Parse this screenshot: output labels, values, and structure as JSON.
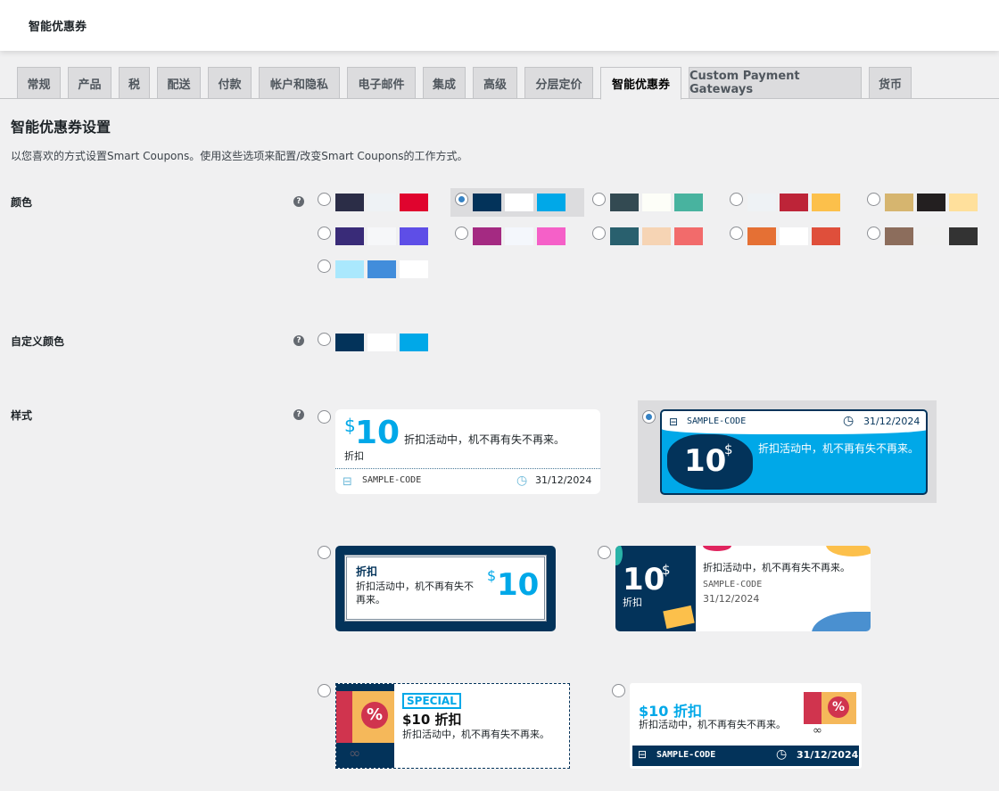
{
  "header": {
    "title": "智能优惠券"
  },
  "tabs": [
    {
      "label": "常规",
      "active": false
    },
    {
      "label": "产品",
      "active": false
    },
    {
      "label": "税",
      "active": false
    },
    {
      "label": "配送",
      "active": false
    },
    {
      "label": "付款",
      "active": false
    },
    {
      "label": "帐户和隐私",
      "active": false
    },
    {
      "label": "电子邮件",
      "active": false
    },
    {
      "label": "集成",
      "active": false
    },
    {
      "label": "高级",
      "active": false
    },
    {
      "label": "分层定价",
      "active": false
    },
    {
      "label": "智能优惠券",
      "active": true
    },
    {
      "label": "Custom Payment Gateways",
      "active": false
    },
    {
      "label": "货币",
      "active": false
    }
  ],
  "page": {
    "title": "智能优惠券设置",
    "description": "以您喜欢的方式设置Smart Coupons。使用这些选项来配置/改变Smart Coupons的工作方式。"
  },
  "settings": {
    "color_label": "颜色",
    "custom_color_label": "自定义颜色",
    "style_label": "样式",
    "help_icon": "?",
    "palettes": [
      {
        "colors": [
          "#2b2d47",
          "#eef2f5",
          "#e0042e"
        ],
        "selected": false
      },
      {
        "colors": [
          "#03335a",
          "#ffffff",
          "#00a8e8"
        ],
        "selected": true
      },
      {
        "colors": [
          "#334a52",
          "#fdfef8",
          "#48b39f"
        ],
        "selected": false
      },
      {
        "colors": [
          "#eef2f5",
          "#bd2438",
          "#fcc04b"
        ],
        "selected": false
      },
      {
        "colors": [
          "#d6b56f",
          "#231f20",
          "#ffe09c"
        ],
        "selected": false
      },
      {
        "colors": [
          "#392b78",
          "#f6f7f9",
          "#5e4ee7"
        ],
        "selected": false
      },
      {
        "colors": [
          "#a42a82",
          "#f4f7fc",
          "#f560c8"
        ],
        "selected": false
      },
      {
        "colors": [
          "#29606e",
          "#f6d4b4",
          "#f26b6b"
        ],
        "selected": false
      },
      {
        "colors": [
          "#e57034",
          "#ffffff",
          "#df4f3b"
        ],
        "selected": false
      },
      {
        "colors": [
          "#8c6d5c",
          "#f0f0f0",
          "#333333"
        ],
        "selected": false
      },
      {
        "colors": [
          "#aae8fd",
          "#428ddb",
          "#ffffff"
        ],
        "selected": false
      }
    ],
    "custom_colors": [
      "#03335a",
      "#ffffff",
      "#00a8e8"
    ],
    "selected_style": 2
  },
  "coupon": {
    "dollar": "$",
    "amount": "10",
    "discount": "折扣",
    "message": "折扣活动中，机不再有失不再来。",
    "code": "SAMPLE-CODE",
    "expiry": "31/12/2024",
    "special": "SPECIAL",
    "amount_full": "$10",
    "amount_discount": "$10 折扣"
  }
}
